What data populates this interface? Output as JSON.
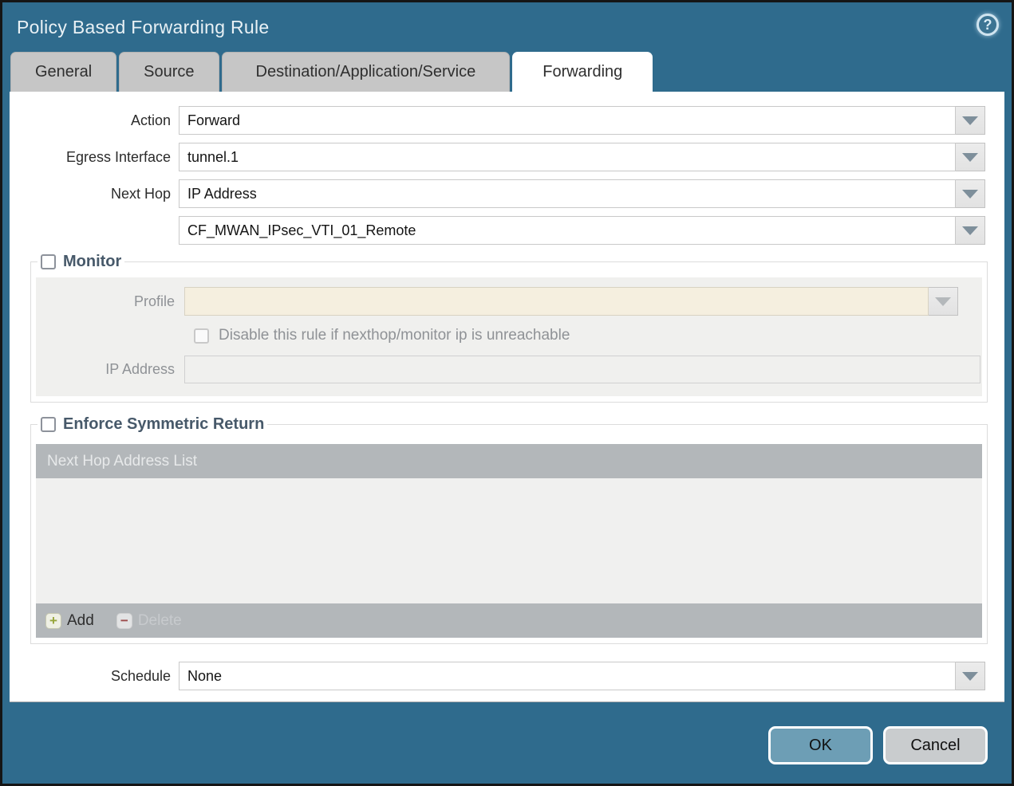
{
  "dialog": {
    "title": "Policy Based Forwarding Rule",
    "help_glyph": "?"
  },
  "tabs": [
    {
      "label": "General",
      "active": false
    },
    {
      "label": "Source",
      "active": false
    },
    {
      "label": "Destination/Application/Service",
      "active": false
    },
    {
      "label": "Forwarding",
      "active": true
    }
  ],
  "form": {
    "action": {
      "label": "Action",
      "value": "Forward"
    },
    "egress_interface": {
      "label": "Egress Interface",
      "value": "tunnel.1"
    },
    "next_hop": {
      "label": "Next Hop",
      "value": "IP Address"
    },
    "next_hop_address": {
      "value": "CF_MWAN_IPsec_VTI_01_Remote"
    },
    "schedule": {
      "label": "Schedule",
      "value": "None"
    }
  },
  "monitor": {
    "legend": "Monitor",
    "checked": false,
    "profile": {
      "label": "Profile",
      "value": ""
    },
    "disable_checkbox_label": "Disable this rule if nexthop/monitor ip is unreachable",
    "ip_address": {
      "label": "IP Address",
      "value": ""
    }
  },
  "symmetric_return": {
    "legend": "Enforce Symmetric Return",
    "checked": false,
    "table": {
      "header": "Next Hop Address List",
      "rows": []
    },
    "add_label": "Add",
    "add_glyph": "+",
    "delete_label": "Delete",
    "delete_glyph": "−",
    "delete_enabled": false
  },
  "footer": {
    "ok_label": "OK",
    "cancel_label": "Cancel"
  },
  "colors": {
    "titlebar": "#2f6b8d",
    "active_tab": "#ffffff",
    "inactive_tab": "#c6c6c6",
    "ok_button": "#6d9eb5",
    "cancel_button": "#c9ccce",
    "disabled_field_beige": "#f5efdf",
    "table_chrome": "#b3b7ba"
  }
}
